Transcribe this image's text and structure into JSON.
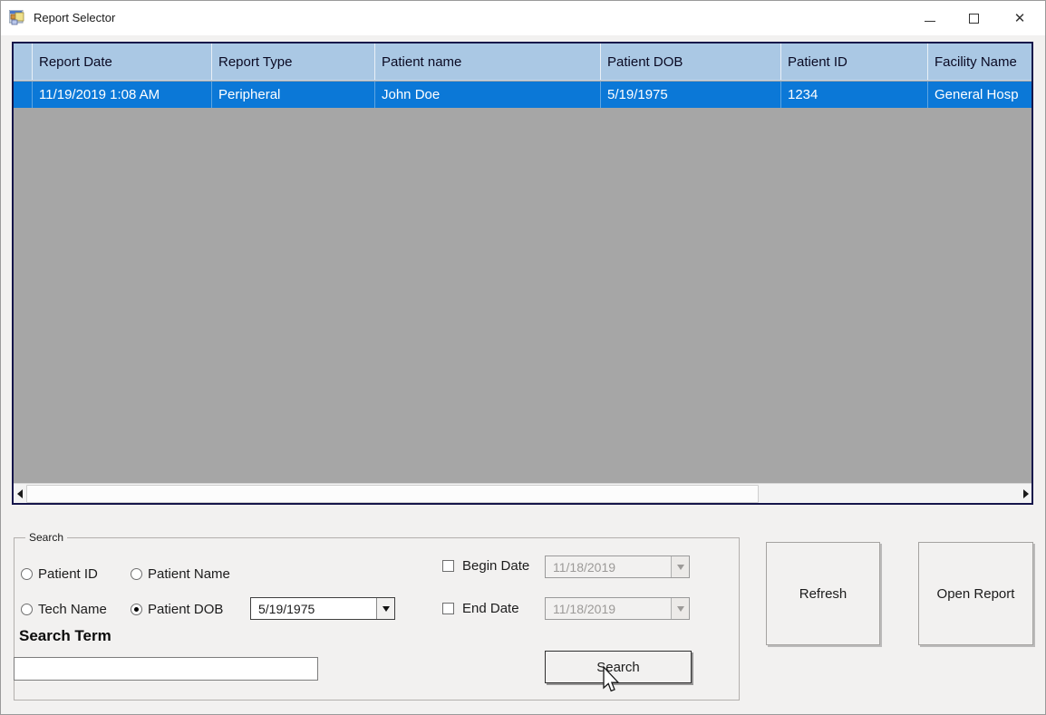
{
  "window": {
    "title": "Report Selector",
    "icons": {
      "app": "form-window-icon",
      "minimize": "minimize-line",
      "maximize": "maximize-square",
      "close": "✕",
      "scroll_left": "left-arrow",
      "scroll_right": "right-arrow",
      "dropdown": "down-arrow",
      "cursor": "arrow-pointer"
    }
  },
  "colors": {
    "grid_header_bg": "#aac8e4",
    "selected_row_bg": "#0b78d7",
    "grid_empty_bg": "#a6a6a6",
    "grid_border": "#15154a",
    "panel_bg": "#f2f1f0"
  },
  "grid": {
    "columns": [
      "Report Date",
      "Report Type",
      "Patient name",
      "Patient DOB",
      "Patient ID",
      "Facility Name"
    ],
    "rows": [
      [
        "11/19/2019 1:08 AM",
        "Peripheral",
        "John Doe",
        "5/19/1975",
        "1234",
        "General Hosp"
      ]
    ],
    "selected_row_index": 0
  },
  "search": {
    "group_label": "Search",
    "radios": [
      {
        "label": "Patient ID",
        "selected": false
      },
      {
        "label": "Patient Name",
        "selected": false
      },
      {
        "label": "Tech Name",
        "selected": false
      },
      {
        "label": "Patient DOB",
        "selected": true
      }
    ],
    "dob_combo_value": "5/19/1975",
    "begin_date": {
      "label": "Begin Date",
      "checked": false,
      "value": "11/18/2019",
      "enabled": false
    },
    "end_date": {
      "label": "End Date",
      "checked": false,
      "value": "11/18/2019",
      "enabled": false
    },
    "search_term_label": "Search Term",
    "search_term_value": "",
    "search_button_label": "Search"
  },
  "actions": {
    "refresh_label": "Refresh",
    "open_report_label": "Open Report"
  }
}
